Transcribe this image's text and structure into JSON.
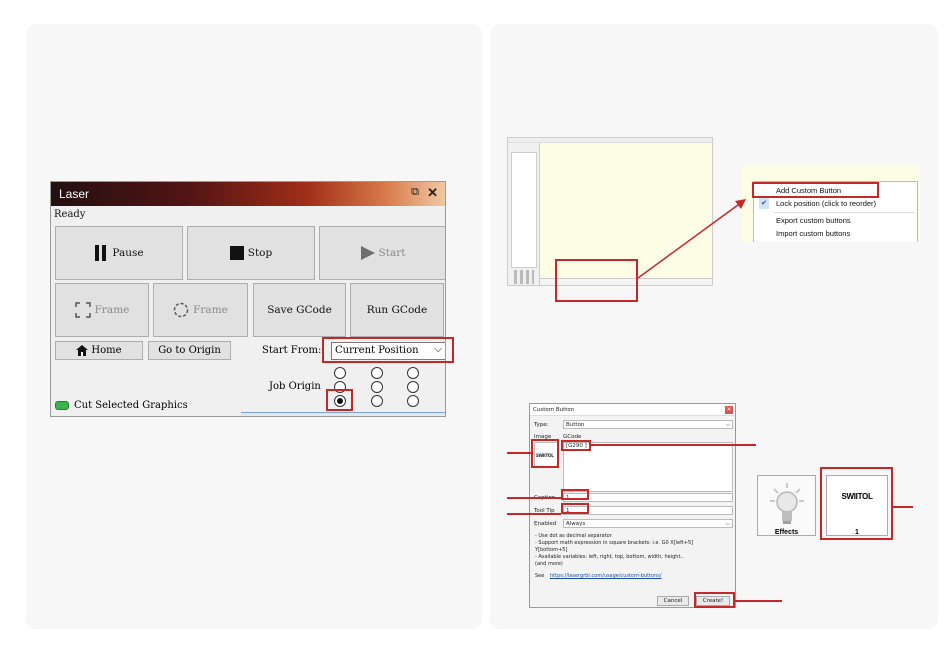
{
  "laser_panel": {
    "title": "Laser",
    "status": "Ready",
    "pause_label": "Pause",
    "stop_label": "Stop",
    "start_label": "Start",
    "frame_label_1": "Frame",
    "frame_label_2": "Frame",
    "save_gcode_label": "Save GCode",
    "run_gcode_label": "Run GCode",
    "home_label": "Home",
    "go_to_origin_label": "Go to Origin",
    "start_from_label": "Start From:",
    "start_from_value": "Current Position",
    "job_origin_label": "Job Origin",
    "cut_selected_label": "Cut Selected Graphics"
  },
  "context_menu": {
    "items": [
      "Add Custom Button",
      "Lock position (click to reorder)",
      "Export custom buttons",
      "Import custom buttons"
    ]
  },
  "custom_button_dialog": {
    "title": "Custom Button",
    "type_label": "Type:",
    "type_value": "Button",
    "image_label": "Image",
    "gcode_label": "GCode",
    "gcode_value": "[G290 ]",
    "image_logo": "SWIITOL",
    "caption_label": "Caption",
    "caption_value": "1",
    "tooltip_label": "Tool Tip",
    "tooltip_value": "1",
    "enabled_label": "Enabled",
    "enabled_value": "Always",
    "note_1": "- Use dot as decimal separator",
    "note_2": "- Support math expression in square brackets: i.e. G0 X[left+5]",
    "note_3": "Y[bottom+5]",
    "note_4": "- Available variables: left, right, top, bottom, width, height..",
    "note_5": "(and more)",
    "see_label": "See",
    "link_text": "https://lasergrbl.com/usage/custom-buttons/",
    "cancel_label": "Cancel",
    "create_label": "Create!"
  },
  "result_tiles": {
    "left_caption": "Effects",
    "right_logo": "SWIITOL",
    "right_caption": "1"
  },
  "colors": {
    "annotation_red": "#c62828",
    "canvas_yellow": "#fdfde6"
  }
}
